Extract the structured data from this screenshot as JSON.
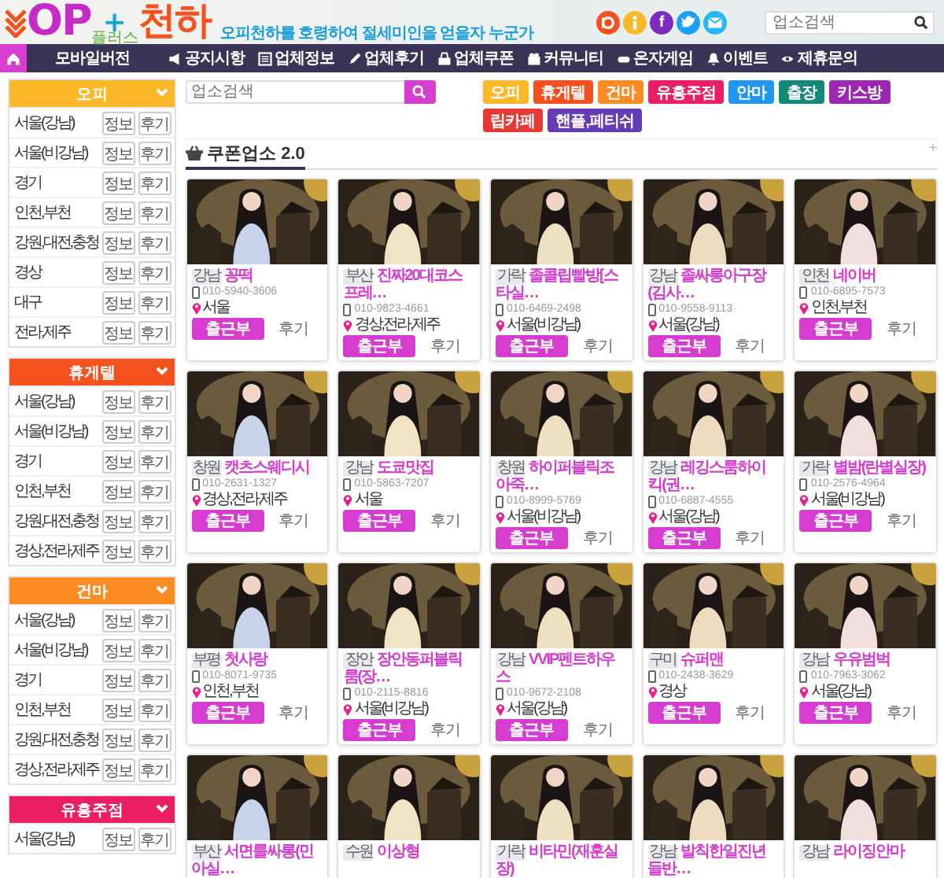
{
  "header": {
    "logo": {
      "main": "OP",
      "plus": "+",
      "name": "천하",
      "sub": "플러스"
    },
    "slogan": "오피천하를 호령하여 절세미인을 얻을자 누군가",
    "social": [
      {
        "kind": "blog"
      },
      {
        "kind": "info"
      },
      {
        "kind": "facebook",
        "glyph": "f"
      },
      {
        "kind": "twitter"
      },
      {
        "kind": "mail"
      }
    ],
    "search": {
      "placeholder": "업소검색"
    }
  },
  "nav": [
    {
      "kind": "home"
    },
    {
      "kind": "mobile",
      "label": "모바일버전"
    },
    {
      "kind": "notice",
      "label": "공지시항"
    },
    {
      "kind": "info",
      "label": "업체정보"
    },
    {
      "kind": "review",
      "label": "업체후기"
    },
    {
      "kind": "coupon",
      "label": "업체쿠폰"
    },
    {
      "kind": "community",
      "label": "커뮤니티"
    },
    {
      "kind": "game",
      "label": "온자게임"
    },
    {
      "kind": "event",
      "label": "이벤트"
    },
    {
      "kind": "partner",
      "label": "제휴문의"
    }
  ],
  "sidebar": [
    {
      "title": "오피",
      "color": "#fbb829",
      "rows": [
        {
          "region": "서울(강남)",
          "info": "정보",
          "review": "후기"
        },
        {
          "region": "서울(비강남)",
          "info": "정보",
          "review": "후기"
        },
        {
          "region": "경기",
          "info": "정보",
          "review": "후기"
        },
        {
          "region": "인천,부천",
          "info": "정보",
          "review": "후기"
        },
        {
          "region": "강원,대전,충청",
          "info": "정보",
          "review": "후기"
        },
        {
          "region": "경상",
          "info": "정보",
          "review": "후기"
        },
        {
          "region": "대구",
          "info": "정보",
          "review": "후기"
        },
        {
          "region": "전라,제주",
          "info": "정보",
          "review": "후기"
        }
      ]
    },
    {
      "title": "휴게텔",
      "color": "#f4511e",
      "rows": [
        {
          "region": "서울(강남)",
          "info": "정보",
          "review": "후기"
        },
        {
          "region": "서울(비강남)",
          "info": "정보",
          "review": "후기"
        },
        {
          "region": "경기",
          "info": "정보",
          "review": "후기"
        },
        {
          "region": "인천,부천",
          "info": "정보",
          "review": "후기"
        },
        {
          "region": "강원,대전,충청",
          "info": "정보",
          "review": "후기"
        },
        {
          "region": "경상,전라,제주",
          "info": "정보",
          "review": "후기"
        }
      ]
    },
    {
      "title": "건마",
      "color": "#fb8c24",
      "rows": [
        {
          "region": "서울(강남)",
          "info": "정보",
          "review": "후기"
        },
        {
          "region": "서울(비강남)",
          "info": "정보",
          "review": "후기"
        },
        {
          "region": "경기",
          "info": "정보",
          "review": "후기"
        },
        {
          "region": "인천,부천",
          "info": "정보",
          "review": "후기"
        },
        {
          "region": "강원,대전,충청",
          "info": "정보",
          "review": "후기"
        },
        {
          "region": "경상,전라,제주",
          "info": "정보",
          "review": "후기"
        }
      ]
    },
    {
      "title": "유흥주점",
      "color": "#e91e63",
      "rows": [
        {
          "region": "서울(강남)",
          "info": "정보",
          "review": "후기"
        }
      ]
    }
  ],
  "main_search": {
    "placeholder": "업소검색"
  },
  "categories": [
    {
      "label": "오피",
      "color": "#fbb829"
    },
    {
      "label": "휴게텔",
      "color": "#f4511e"
    },
    {
      "label": "건마",
      "color": "#fb8c24"
    },
    {
      "label": "유흥주점",
      "color": "#e91e63"
    },
    {
      "label": "안마",
      "color": "#2196f3"
    },
    {
      "label": "출장",
      "color": "#13897a"
    },
    {
      "label": "키스방",
      "color": "#9c27b0"
    },
    {
      "label": "립카페",
      "color": "#e53935"
    },
    {
      "label": "핸플,페티쉬",
      "color": "#673ab7"
    }
  ],
  "section": {
    "title": "쿠폰업소 2.0",
    "more": "+"
  },
  "cards": [
    {
      "tag": "강남",
      "name": "꽁떡",
      "phone": "010-5940-3606",
      "region": "서울",
      "attendance": "출근부",
      "review": "후기"
    },
    {
      "tag": "부산",
      "name": "진짜20대코스프레…",
      "phone": "010-9823-4661",
      "region": "경상,전라,제주",
      "attendance": "출근부",
      "review": "후기"
    },
    {
      "tag": "가락",
      "name": "졸콜립빨방[스타실…",
      "phone": "010-6469-2498",
      "region": "서울(비강남)",
      "attendance": "출근부",
      "review": "후기"
    },
    {
      "tag": "강남",
      "name": "졸싸롱아구장(김사…",
      "phone": "010-9558-9113",
      "region": "서울(강남)",
      "attendance": "출근부",
      "review": "후기"
    },
    {
      "tag": "인천",
      "name": "네이버",
      "phone": "010-6895-7573",
      "region": "인천,부천",
      "attendance": "출근부",
      "review": "후기"
    },
    {
      "tag": "창원",
      "name": "캣츠스웨디시",
      "phone": "010-2631-1327",
      "region": "경상,전라,제주",
      "attendance": "출근부",
      "review": "후기"
    },
    {
      "tag": "강남",
      "name": "도쿄맛집",
      "phone": "010-5863-7207",
      "region": "서울",
      "attendance": "출근부",
      "review": "후기"
    },
    {
      "tag": "창원",
      "name": "하이퍼블릭조아죽…",
      "phone": "010-8999-5769",
      "region": "서울(비강남)",
      "attendance": "출근부",
      "review": "후기"
    },
    {
      "tag": "강남",
      "name": "레깅스룸하이킥(권…",
      "phone": "010-6887-4555",
      "region": "서울(강남)",
      "attendance": "출근부",
      "review": "후기"
    },
    {
      "tag": "가락",
      "name": "별밤(란별실장)",
      "phone": "010-2576-4964",
      "region": "서울(비강남)",
      "attendance": "출근부",
      "review": "후기"
    },
    {
      "tag": "부평",
      "name": "첫사랑",
      "phone": "010-8071-9735",
      "region": "인천,부천",
      "attendance": "출근부",
      "review": "후기"
    },
    {
      "tag": "장안",
      "name": "장안동퍼블릭룸(장…",
      "phone": "010-2115-8816",
      "region": "서울(비강남)",
      "attendance": "출근부",
      "review": "후기"
    },
    {
      "tag": "강남",
      "name": "VVIP펜트하우스",
      "phone": "010-9672-2108",
      "region": "서울(강남)",
      "attendance": "출근부",
      "review": "후기"
    },
    {
      "tag": "구미",
      "name": "슈퍼맨",
      "phone": "010-2438-3629",
      "region": "경상",
      "attendance": "출근부",
      "review": "후기"
    },
    {
      "tag": "강남",
      "name": "우유범벅",
      "phone": "010-7963-3062",
      "region": "서울(강남)",
      "attendance": "출근부",
      "review": "후기"
    },
    {
      "tag": "부산",
      "name": "서면룰싸롱(민아실…"
    },
    {
      "tag": "수원",
      "name": "이상형"
    },
    {
      "tag": "가락",
      "name": "비타민(재훈실장)"
    },
    {
      "tag": "강남",
      "name": "발칙한일진년들반…"
    },
    {
      "tag": "강남",
      "name": "라이징안마"
    }
  ]
}
